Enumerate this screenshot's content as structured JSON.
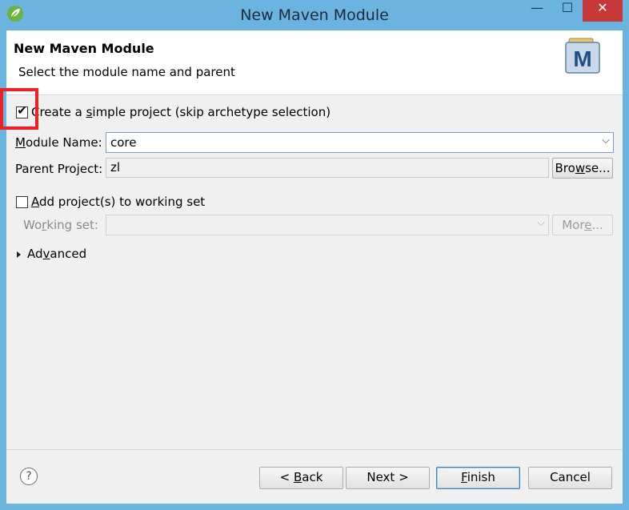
{
  "window": {
    "title": "New Maven Module",
    "minimize": "—",
    "maximize": "☐",
    "close": "✕"
  },
  "banner": {
    "title": "New Maven Module",
    "description": "Select the module name and parent",
    "logo_letter": "M"
  },
  "simple_project": {
    "checked": true,
    "label_pre": "Create a ",
    "label_mnemonic": "s",
    "label_post": "imple project (skip archetype selection)"
  },
  "module_name": {
    "label_mnemonic": "M",
    "label_post": "odule Name:",
    "value": "core"
  },
  "parent_project": {
    "label": "Parent Project:",
    "value": "zl",
    "browse_pre": "Bro",
    "browse_mnemonic": "w",
    "browse_post": "se..."
  },
  "working_set": {
    "checked": false,
    "checkbox_label_mnemonic": "A",
    "checkbox_label_post": "dd project(s) to working set",
    "label_pre": "Wo",
    "label_mnemonic": "r",
    "label_post": "king set:",
    "value": "",
    "more_pre": "Mor",
    "more_mnemonic": "e",
    "more_post": "..."
  },
  "advanced": {
    "label_pre": "Ad",
    "label_mnemonic": "v",
    "label_post": "anced"
  },
  "footer": {
    "help": "?",
    "back_pre": "< ",
    "back_mnemonic": "B",
    "back_post": "ack",
    "next": "Next >",
    "finish_mnemonic": "F",
    "finish_post": "inish",
    "cancel": "Cancel"
  },
  "colors": {
    "title_bar": "#6cb4e0",
    "close_button": "#c7383a",
    "highlight_box": "#ee2222"
  }
}
